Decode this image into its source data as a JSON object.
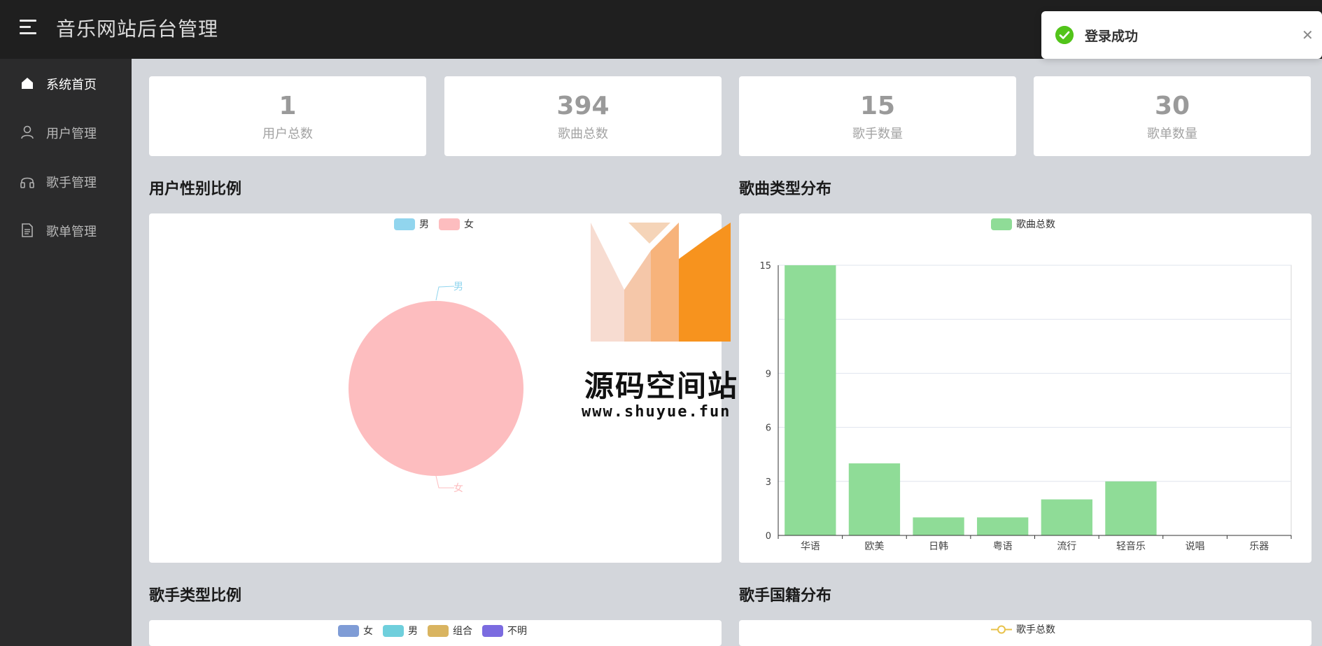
{
  "header": {
    "title": "音乐网站后台管理",
    "menu_icon": "hamburger-icon"
  },
  "sidebar": {
    "items": [
      {
        "label": "系统首页",
        "icon": "home-icon",
        "active": true
      },
      {
        "label": "用户管理",
        "icon": "user-icon",
        "active": false
      },
      {
        "label": "歌手管理",
        "icon": "headphones-icon",
        "active": false
      },
      {
        "label": "歌单管理",
        "icon": "document-icon",
        "active": false
      }
    ]
  },
  "stats": [
    {
      "value": "1",
      "label": "用户总数"
    },
    {
      "value": "394",
      "label": "歌曲总数"
    },
    {
      "value": "15",
      "label": "歌手数量"
    },
    {
      "value": "30",
      "label": "歌单数量"
    }
  ],
  "sections": {
    "gender": "用户性别比例",
    "song_type": "歌曲类型分布",
    "singer_type": "歌手类型比例",
    "singer_nation": "歌手国籍分布"
  },
  "toast": {
    "message": "登录成功",
    "status": "success"
  },
  "watermark": {
    "text": "源码空间站",
    "url": "www.shuyue.fun"
  },
  "chart_data": [
    {
      "type": "pie",
      "title": "用户性别比例",
      "legend": [
        "男",
        "女"
      ],
      "colors": [
        "#91d5ee",
        "#fdbdbf"
      ],
      "slice_labels": [
        "男",
        "女"
      ],
      "values": [
        0,
        1
      ]
    },
    {
      "type": "bar",
      "title": "歌曲类型分布",
      "legend": [
        "歌曲总数"
      ],
      "color": "#8fdc97",
      "categories": [
        "华语",
        "欧美",
        "日韩",
        "粤语",
        "流行",
        "轻音乐",
        "说唱",
        "乐器"
      ],
      "series": [
        {
          "name": "歌曲总数",
          "values": [
            15,
            4,
            1,
            1,
            2,
            3,
            0,
            0
          ]
        }
      ],
      "yticks": [
        0,
        3,
        6,
        9,
        15
      ],
      "ylim": [
        0,
        15
      ],
      "grid": true
    },
    {
      "type": "pie",
      "title": "歌手类型比例",
      "legend": [
        "女",
        "男",
        "组合",
        "不明"
      ],
      "colors": [
        "#7f9cd6",
        "#6fcfdc",
        "#d9b460",
        "#7b6be0"
      ]
    },
    {
      "type": "line",
      "title": "歌手国籍分布",
      "legend": [
        "歌手总数"
      ],
      "color": "#e8c24a"
    }
  ]
}
